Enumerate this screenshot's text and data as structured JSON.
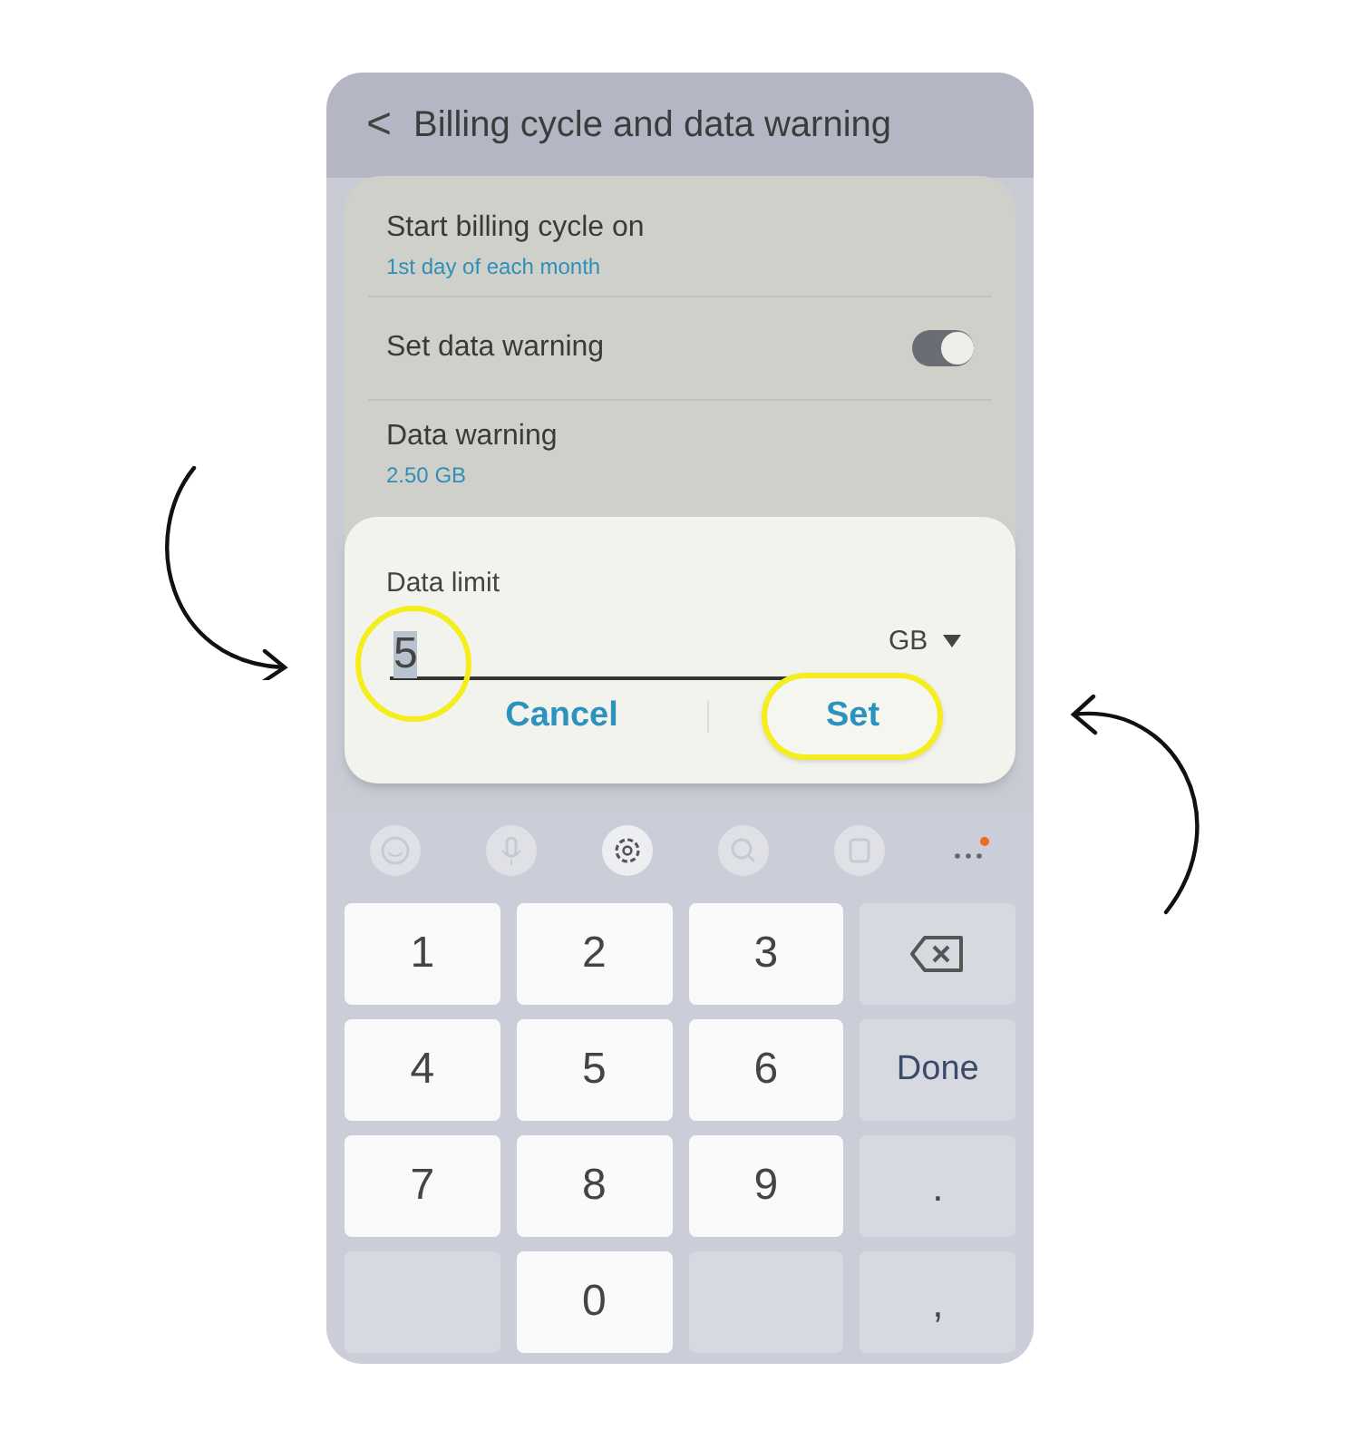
{
  "header": {
    "back": "<",
    "title": "Billing cycle and data warning"
  },
  "settings": [
    {
      "kind": "value",
      "label": "Start billing cycle on",
      "value": "1st day of each month"
    },
    {
      "kind": "toggle",
      "label": "Set data warning",
      "on": true
    },
    {
      "kind": "value",
      "label": "Data warning",
      "value": "2.50 GB"
    }
  ],
  "dialog": {
    "title": "Data limit",
    "value": "5",
    "value_highlighted": true,
    "unit": "GB",
    "buttons": [
      {
        "label": "Cancel",
        "highlighted": false
      },
      {
        "label": "Set",
        "highlighted": true
      }
    ]
  },
  "keyboard": {
    "keys": [
      {
        "kind": "digit",
        "label": "1"
      },
      {
        "kind": "digit",
        "label": "2"
      },
      {
        "kind": "digit",
        "label": "3"
      },
      {
        "kind": "backspace"
      },
      {
        "kind": "digit",
        "label": "4"
      },
      {
        "kind": "digit",
        "label": "5"
      },
      {
        "kind": "digit",
        "label": "6"
      },
      {
        "kind": "action",
        "label": "Done"
      },
      {
        "kind": "digit",
        "label": "7"
      },
      {
        "kind": "digit",
        "label": "8"
      },
      {
        "kind": "digit",
        "label": "9"
      },
      {
        "kind": "symbol",
        "label": "."
      },
      {
        "kind": "blank"
      },
      {
        "kind": "digit",
        "label": "0"
      },
      {
        "kind": "blank"
      },
      {
        "kind": "symbol",
        "label": ","
      }
    ]
  }
}
